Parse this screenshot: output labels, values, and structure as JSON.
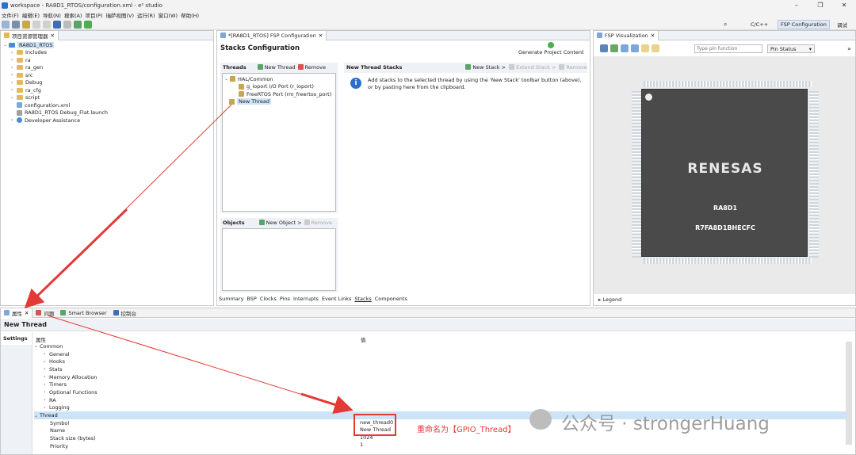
{
  "window": {
    "title": "workspace - RA8D1_RTOS/configuration.xml - e² studio"
  },
  "menu": [
    "文件(F)",
    "编辑(E)",
    "导航(N)",
    "搜索(A)",
    "项目(P)",
    "瑞萨视图(V)",
    "运行(R)",
    "窗口(W)",
    "帮助(H)"
  ],
  "perspectives": {
    "cc": "C/C++",
    "fsp": "FSP Configuration",
    "debug": "调试"
  },
  "explorer": {
    "tab": "项目资源管理器",
    "root": "RA8D1_RTOS",
    "items": [
      "Includes",
      "ra",
      "ra_gen",
      "src",
      "Debug",
      "ra_cfg",
      "script",
      "configuration.xml",
      "RA8D1_RTOS Debug_Flat.launch",
      "Developer Assistance"
    ]
  },
  "editor": {
    "tab": "*[RA8D1_RTOS] FSP Configuration",
    "title": "Stacks Configuration",
    "generate": "Generate Project Content",
    "threads": {
      "label": "Threads",
      "new": "New Thread",
      "remove": "Remove",
      "group": "HAL/Common",
      "items": [
        "g_ioport I/O Port (r_ioport)",
        "FreeRTOS Port (rm_freertos_port)"
      ],
      "new_item": "New Thread"
    },
    "stacks": {
      "label": "New Thread Stacks",
      "new": "New Stack >",
      "extend": "Extend Stack >",
      "remove": "Remove",
      "info": "Add stacks to the selected thread by using the 'New Stack' toolbar button (above), or by pasting here from the clipboard."
    },
    "objects": {
      "label": "Objects",
      "new": "New Object >",
      "remove": "Remove"
    },
    "bottom_tabs": [
      "Summary",
      "BSP",
      "Clocks",
      "Pins",
      "Interrupts",
      "Event Links",
      "Stacks",
      "Components"
    ]
  },
  "fspviz": {
    "tab": "FSP Visualization",
    "search_placeholder": "Type pin function",
    "pin_status": "Pin Status",
    "brand": "RENESAS",
    "chip": "RA8D1",
    "part": "R7FA8D1BHECFC",
    "legend": "Legend"
  },
  "props": {
    "tabs": [
      "属性",
      "问题",
      "Smart Browser",
      "控制台"
    ],
    "title": "New Thread",
    "side": "Settings",
    "col_prop": "属性",
    "col_val": "值",
    "common": "Common",
    "common_items": [
      "General",
      "Hooks",
      "Stats",
      "Memory Allocation",
      "Timers",
      "Optional Functions",
      "RA",
      "Logging"
    ],
    "thread": "Thread",
    "rows": [
      {
        "k": "Symbol",
        "v": "new_thread0"
      },
      {
        "k": "Name",
        "v": "New Thread"
      },
      {
        "k": "Stack size (bytes)",
        "v": "1024"
      },
      {
        "k": "Priority",
        "v": "1"
      }
    ]
  },
  "annotation": {
    "note": "重命名为【GPIO_Thread】",
    "watermark": "公众号 · strongerHuang"
  },
  "colors": {
    "accent": "#2b6fcf",
    "highlight": "#cde3f7",
    "annot": "#e53935"
  }
}
